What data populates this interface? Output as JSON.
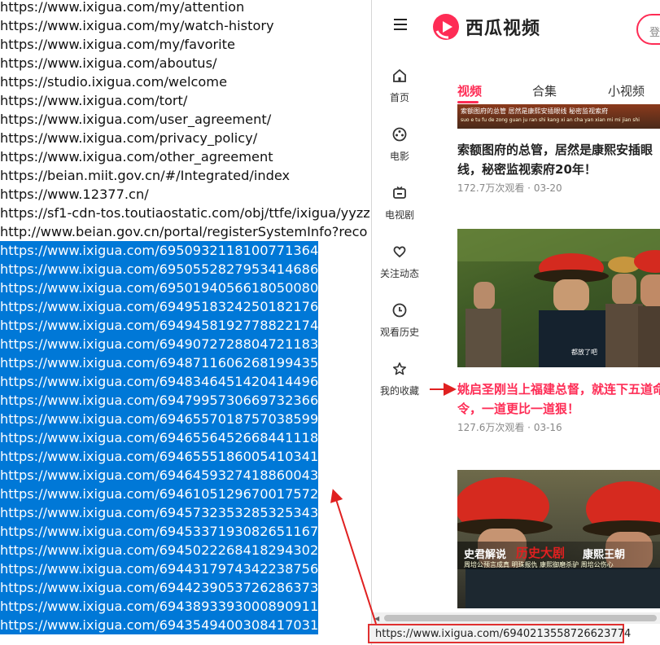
{
  "url_list": {
    "plain": [
      "https://www.ixigua.com/my/attention",
      "https://www.ixigua.com/my/watch-history",
      "https://www.ixigua.com/my/favorite",
      "https://www.ixigua.com/aboutus/",
      "https://studio.ixigua.com/welcome",
      "https://www.ixigua.com/tort/",
      "https://www.ixigua.com/user_agreement/",
      "https://www.ixigua.com/privacy_policy/",
      "https://www.ixigua.com/other_agreement",
      "https://beian.miit.gov.cn/#/Integrated/index",
      "https://www.12377.cn/",
      "https://sf1-cdn-tos.toutiaostatic.com/obj/ttfe/ixigua/yyzz",
      "http://www.beian.gov.cn/portal/registerSystemInfo?reco"
    ],
    "selected": [
      "https://www.ixigua.com/6950932118100771364",
      "https://www.ixigua.com/6950552827953414686",
      "https://www.ixigua.com/6950194056618050080",
      "https://www.ixigua.com/6949518324250182176",
      "https://www.ixigua.com/6949458192778822174",
      "https://www.ixigua.com/6949072728804721183",
      "https://www.ixigua.com/6948711606268199435",
      "https://www.ixigua.com/6948346451420414496",
      "https://www.ixigua.com/6947995730669732366",
      "https://www.ixigua.com/6946557018757038599",
      "https://www.ixigua.com/6946556452668441118",
      "https://www.ixigua.com/6946555186005410341",
      "https://www.ixigua.com/6946459327418860043",
      "https://www.ixigua.com/6946105129670017572",
      "https://www.ixigua.com/6945732353285325343",
      "https://www.ixigua.com/6945337193082651167",
      "https://www.ixigua.com/6945022268418294302",
      "https://www.ixigua.com/6944317974342238756",
      "https://www.ixigua.com/6944239053726286373",
      "https://www.ixigua.com/6943893393000890911",
      "https://www.ixigua.com/6943549400308417031"
    ]
  },
  "app": {
    "logo_text": "西瓜视频",
    "login_text": "登",
    "brand_color": "#fe2c55"
  },
  "sidebar": {
    "items": [
      {
        "label": "首页",
        "icon": "home-icon"
      },
      {
        "label": "电影",
        "icon": "film-reel-icon"
      },
      {
        "label": "电视剧",
        "icon": "tv-icon"
      },
      {
        "label": "关注动态",
        "icon": "heart-icon"
      },
      {
        "label": "观看历史",
        "icon": "clock-icon"
      },
      {
        "label": "我的收藏",
        "icon": "star-icon"
      }
    ]
  },
  "tabs": [
    {
      "label": "视频",
      "active": true
    },
    {
      "label": "合集",
      "active": false
    },
    {
      "label": "小视频",
      "active": false
    }
  ],
  "videos": [
    {
      "thumb_caption": "索额图府的总管 居然是康熙安插眼线 秘密监视索府",
      "thumb_caption_small": "suo e tu fu de zong guan ju ran shi kang xi an cha yan xian mi mi jian shi",
      "title": "索额图府的总管，居然是康熙安插眼线，秘密监视索府20年！",
      "views": "172.7万次观看",
      "date": "03-20"
    },
    {
      "thumb_caption": "都放了吧",
      "title": "姚启圣刚当上福建总督，就连下五道命令，一道更比一道狠！",
      "views": "127.6万次观看",
      "date": "03-16"
    },
    {
      "sub1": "史君解说",
      "sub2": "历史大剧",
      "sub3": "康熙王朝",
      "sub4": "周培公预言成真 明珠报仇 康熙御磨杀驴 周培公伤心"
    }
  ],
  "status_bar": {
    "url": "https://www.ixigua.com/6940213558726623774"
  }
}
